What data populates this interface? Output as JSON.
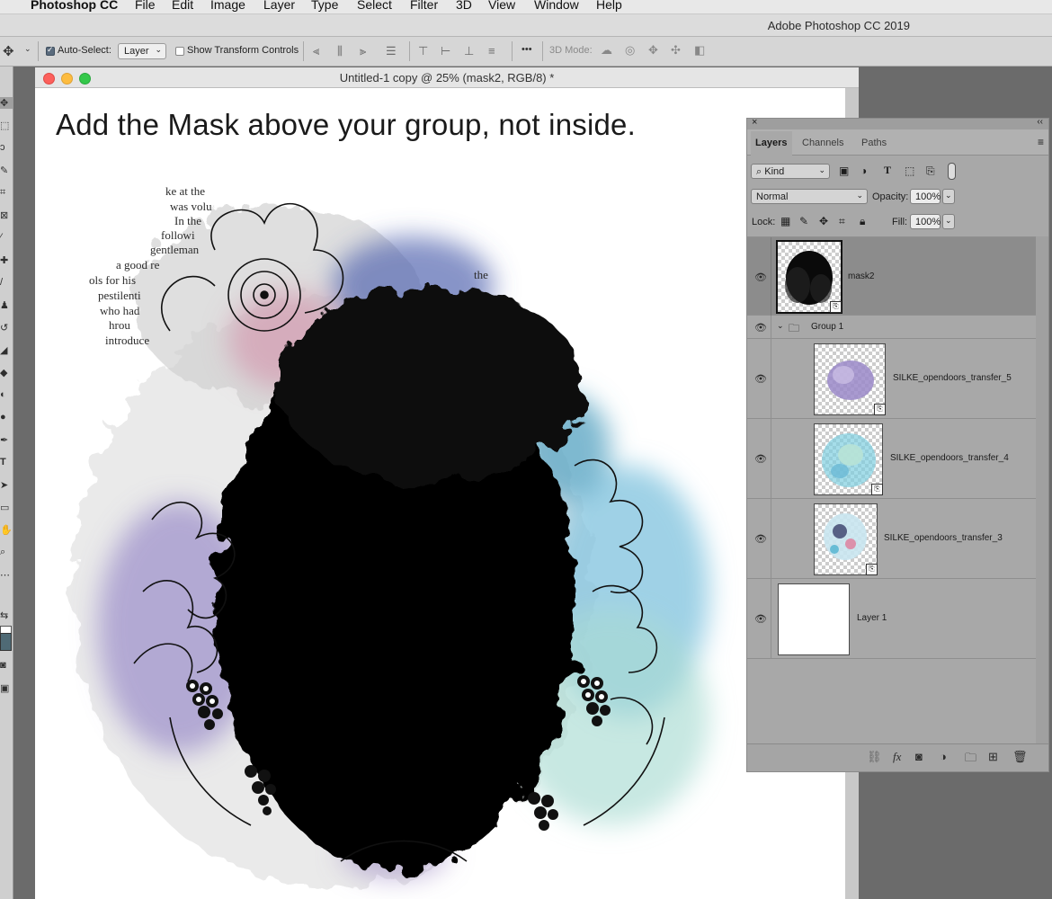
{
  "menubar": {
    "apple": "",
    "app_name": "Photoshop CC",
    "items": [
      "File",
      "Edit",
      "Image",
      "Layer",
      "Type",
      "Select",
      "Filter",
      "3D",
      "View",
      "Window",
      "Help"
    ]
  },
  "window_title": "Adobe Photoshop CC 2019",
  "options_bar": {
    "auto_select_label": "Auto-Select:",
    "auto_select_checked": true,
    "auto_select_target": "Layer",
    "show_transform_label": "Show Transform Controls",
    "show_transform_checked": false,
    "more": "•••",
    "mode_3d_label": "3D Mode:"
  },
  "document": {
    "title": "Untitled-1 copy @ 25% (mask2, RGB/8) *",
    "heading": "Add the Mask above your group, not inside.",
    "artwork_text": [
      "ke at the",
      "was volu",
      "In the",
      "followi",
      "gentleman",
      "a good re",
      "ols for his",
      "pestilenti",
      "who had",
      "hrou",
      "introduce",
      "the"
    ]
  },
  "layers_panel": {
    "tabs": [
      "Layers",
      "Channels",
      "Paths"
    ],
    "active_tab": "Layers",
    "filter_kind": "Kind",
    "blend_mode": "Normal",
    "opacity_label": "Opacity:",
    "opacity_value": "100%",
    "lock_label": "Lock:",
    "fill_label": "Fill:",
    "fill_value": "100%",
    "layers": [
      {
        "name": "mask2",
        "type": "smart-object",
        "selected": true,
        "visible": true
      },
      {
        "name": "Group 1",
        "type": "group",
        "expanded": true,
        "visible": true
      },
      {
        "name": "SILKE_opendoors_transfer_5",
        "type": "smart-object",
        "visible": true
      },
      {
        "name": "SILKE_opendoors_transfer_4",
        "type": "smart-object",
        "visible": true
      },
      {
        "name": "SILKE_opendoors_transfer_3",
        "type": "smart-object",
        "visible": true
      },
      {
        "name": "Layer 1",
        "type": "pixel",
        "visible": true
      }
    ]
  },
  "colors": {
    "canvas_bg": "#ffffff",
    "panel_bg": "#a8a8a8",
    "selected_row": "#8c8c8c"
  }
}
